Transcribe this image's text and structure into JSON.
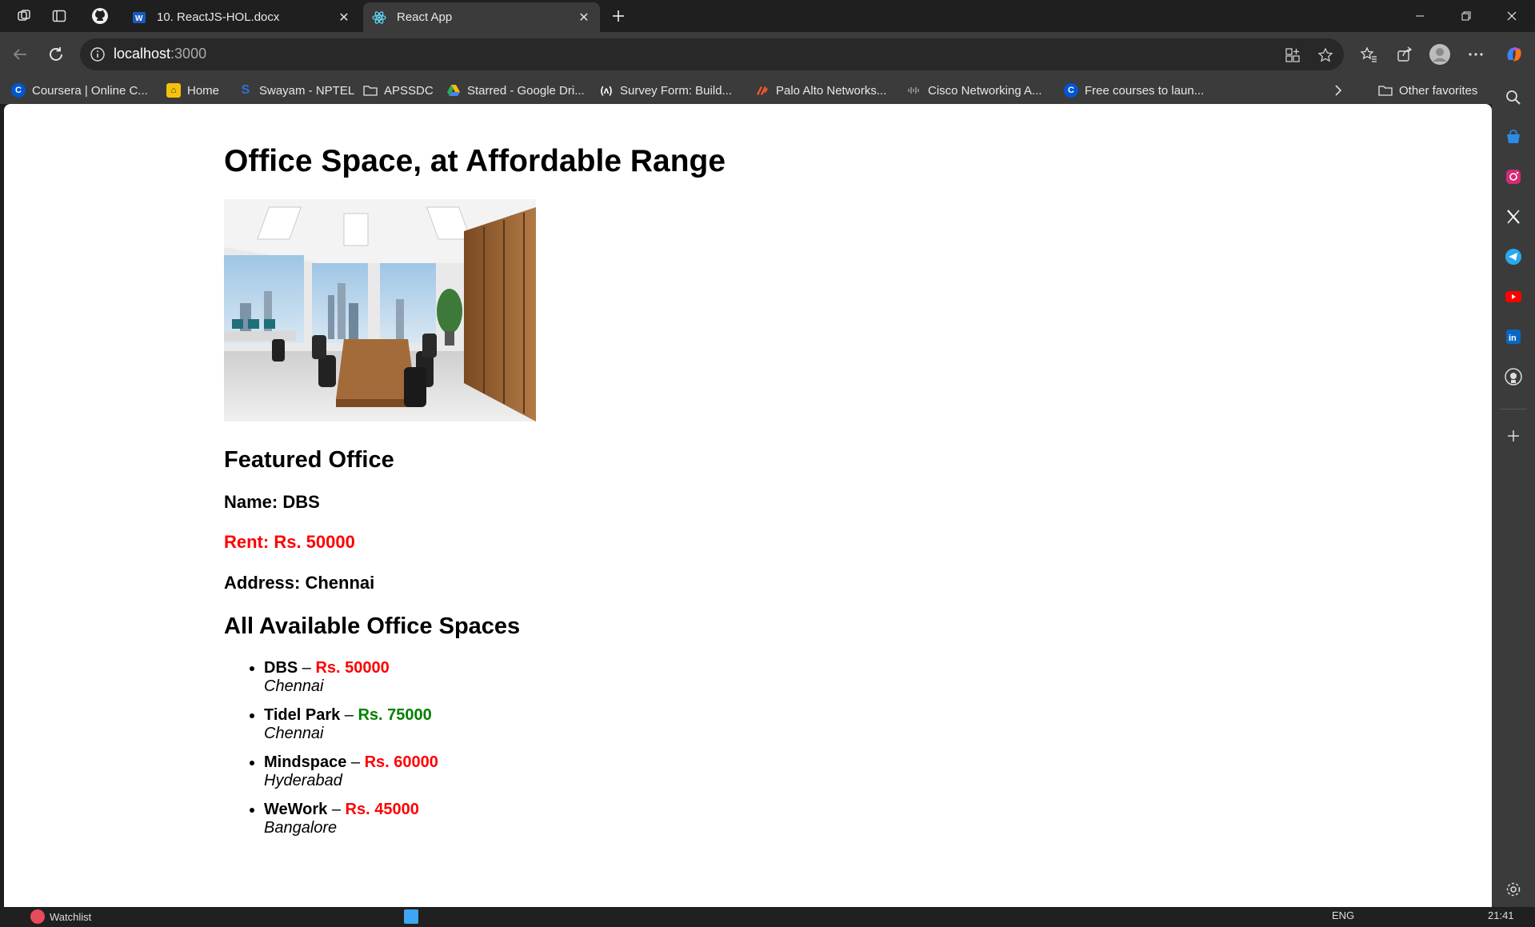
{
  "browser": {
    "tabs": [
      {
        "title": "10. ReactJS-HOL.docx",
        "favicon": "word-icon",
        "active": false
      },
      {
        "title": "React App",
        "favicon": "react-icon",
        "active": true
      }
    ],
    "address": {
      "host": "localhost",
      "port": ":3000"
    },
    "bookmarks": [
      {
        "label": "Coursera | Online C...",
        "icon": "coursera-icon",
        "color": "#0056d2"
      },
      {
        "label": "Home",
        "icon": "home-icon",
        "color": "#f4c20d"
      },
      {
        "label": "Swayam - NPTEL",
        "icon": "swayam-icon",
        "color": "#2f6fd6"
      },
      {
        "label": "APSSDC",
        "icon": "folder-icon",
        "color": "#e6e6e6"
      },
      {
        "label": "Starred - Google Dri...",
        "icon": "drive-icon",
        "color": "#34a853"
      },
      {
        "label": "Survey Form: Build...",
        "icon": "freecodecamp-icon",
        "color": "#0a0a23"
      },
      {
        "label": "Palo Alto Networks...",
        "icon": "paloalto-icon",
        "color": "#fa582d"
      },
      {
        "label": "Cisco Networking A...",
        "icon": "cisco-icon",
        "color": "#555555"
      },
      {
        "label": "Free courses to laun...",
        "icon": "coursera-icon",
        "color": "#0056d2"
      }
    ],
    "other_favorites": "Other favorites"
  },
  "page": {
    "heading": "Office Space, at Affordable Range",
    "featured_heading": "Featured Office",
    "featured": {
      "name_line": "Name: DBS",
      "rent_line": "Rent: Rs. 50000",
      "address_line": "Address: Chennai"
    },
    "all_heading": "All Available Office Spaces",
    "offices": [
      {
        "name": "DBS",
        "sep": " – ",
        "rent": "Rs. 50000",
        "rent_color": "#ff0000",
        "city": "Chennai"
      },
      {
        "name": "Tidel Park",
        "sep": " – ",
        "rent": "Rs. 75000",
        "rent_color": "#008000",
        "city": "Chennai"
      },
      {
        "name": "Mindspace",
        "sep": " – ",
        "rent": "Rs. 60000",
        "rent_color": "#ff0000",
        "city": "Hyderabad"
      },
      {
        "name": "WeWork",
        "sep": " – ",
        "rent": "Rs. 45000",
        "rent_color": "#ff0000",
        "city": "Bangalore"
      }
    ]
  },
  "taskbar": {
    "watchlist": "Watchlist",
    "lang": "ENG",
    "time": "21:41"
  }
}
